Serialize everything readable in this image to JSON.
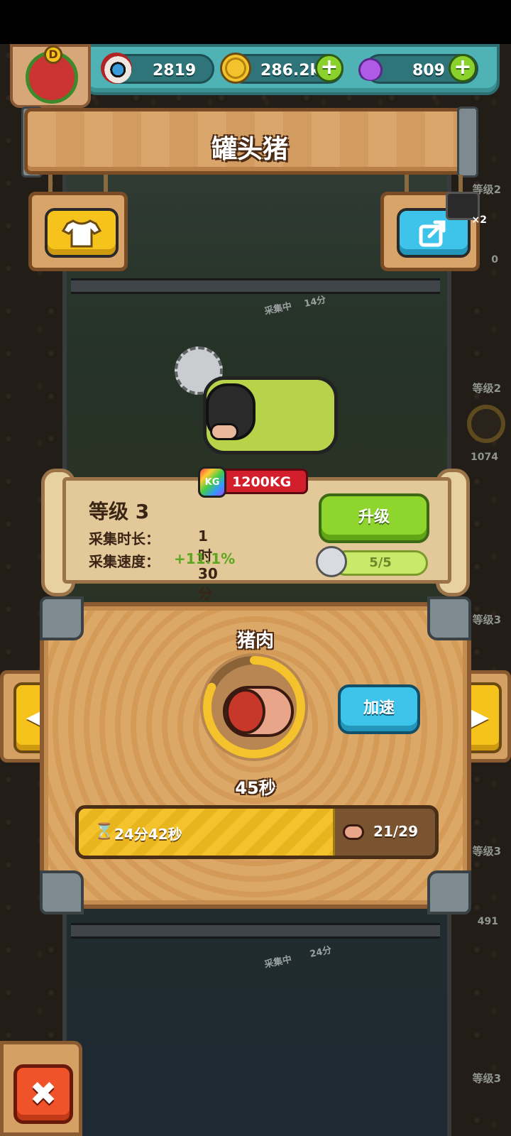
{
  "header": {
    "eyeballs": "2819",
    "coins": "286.2k",
    "potions": "809",
    "plus_glyph": "+",
    "avatar_badge": "D"
  },
  "title": "罐头猪",
  "character": {
    "weight_badge_icon": "KG",
    "weight": "1200KG"
  },
  "info": {
    "level": "等级 3",
    "collect_time_label": "采集时长：",
    "collect_time_value": "1时30分",
    "collect_speed_label": "采集速度：",
    "collect_speed_value": "+11.1%",
    "upgrade_label": "升级",
    "upgrade_progress": "5/5",
    "upgrade_progress_fraction": 1.0
  },
  "product": {
    "name": "猪肉",
    "cycle_timer": "45秒",
    "cycle_progress_fraction": 0.82,
    "speed_up_label": "加速",
    "total_time": "24分42秒",
    "total_progress_fraction": 0.72,
    "count": "21/29",
    "hourglass_glyph": "⌛"
  },
  "background": {
    "collect_tag_1": "采集中",
    "collect_timer_1": "14分",
    "collect_tag_2": "采集中",
    "collect_timer_2": "24分",
    "side_levels": [
      "等级2",
      "等级2",
      "等级3",
      "等级3",
      "等级3"
    ],
    "side_counts": [
      "0",
      "1074",
      "491"
    ],
    "side_item_multiplier": "×2"
  },
  "nav": {
    "left_arrow": "◀",
    "right_arrow": "▶",
    "close_glyph": "✖"
  },
  "icons": {
    "eyeball": "eyeball-icon",
    "coin": "coin-icon",
    "potion": "potion-icon",
    "outfit": "shirt-icon",
    "share": "share-icon",
    "horn": "horned-skull-icon",
    "meat": "meat-icon"
  },
  "colors": {
    "teal_bar": "#4fb2b5",
    "wood": "#d9a56b",
    "green_button": "#8ed62e",
    "blue_button": "#3ec3ea",
    "yellow_button": "#f6c21c",
    "red_button": "#f0532a"
  }
}
